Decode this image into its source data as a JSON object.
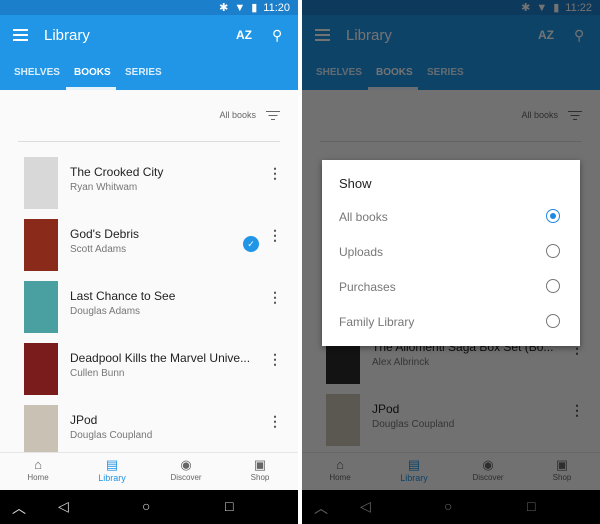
{
  "screens": [
    {
      "status_time": "11:20",
      "title": "Library",
      "tabs": [
        "SHELVES",
        "BOOKS",
        "SERIES"
      ],
      "active_tab": 1,
      "filter_label": "All books",
      "books": [
        {
          "title": "The Crooked City",
          "author": "Ryan Whitwam",
          "cover": "#d8d8d8",
          "checked": false
        },
        {
          "title": "God's Debris",
          "author": "Scott Adams",
          "cover": "#8a2a1a",
          "checked": true
        },
        {
          "title": "Last Chance to See",
          "author": "Douglas Adams",
          "cover": "#4aa0a0",
          "checked": false
        },
        {
          "title": "Deadpool Kills the Marvel Unive...",
          "author": "Cullen Bunn",
          "cover": "#7a1c1c",
          "checked": false
        },
        {
          "title": "JPod",
          "author": "Douglas Coupland",
          "cover": "#c9c2b4",
          "checked": false
        }
      ]
    },
    {
      "status_time": "11:22",
      "title": "Library",
      "tabs": [
        "SHELVES",
        "BOOKS",
        "SERIES"
      ],
      "active_tab": 1,
      "filter_label": "All books",
      "books": [
        {
          "title": "The Aliomenti Saga Box Set (Bo...",
          "author": "Alex Albrinck",
          "cover": "#2a2a2a",
          "checked": false
        },
        {
          "title": "JPod",
          "author": "Douglas Coupland",
          "cover": "#c9c2b4",
          "checked": false
        }
      ],
      "dialog": {
        "title": "Show",
        "options": [
          "All books",
          "Uploads",
          "Purchases",
          "Family Library"
        ],
        "selected": 0
      }
    }
  ],
  "bottom_nav": [
    {
      "label": "Home",
      "icon": "home-icon"
    },
    {
      "label": "Library",
      "icon": "library-icon"
    },
    {
      "label": "Discover",
      "icon": "compass-icon"
    },
    {
      "label": "Shop",
      "icon": "shopping-bag-icon"
    }
  ],
  "bottom_nav_active": 1,
  "colors": {
    "accent": "#2196e6",
    "status_bar": "#1c7fcc"
  }
}
